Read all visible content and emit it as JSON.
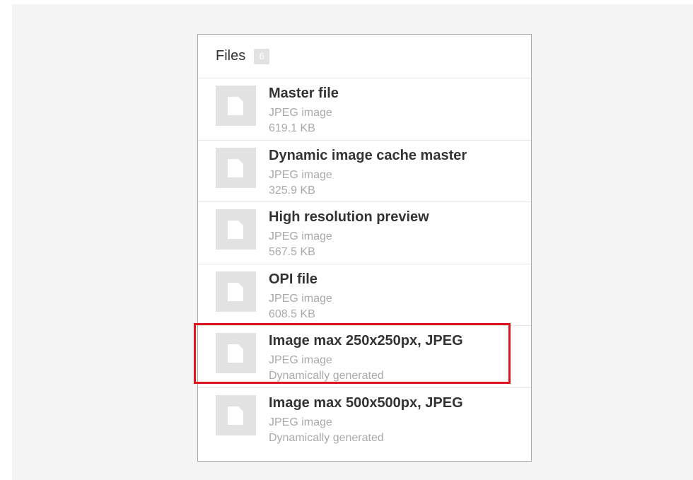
{
  "panel": {
    "title": "Files",
    "count": "6"
  },
  "files": [
    {
      "name": "Master file",
      "type": "JPEG image",
      "meta": "619.1 KB",
      "icon": "file-icon"
    },
    {
      "name": "Dynamic image cache master",
      "type": "JPEG image",
      "meta": "325.9 KB",
      "icon": "file-icon"
    },
    {
      "name": "High resolution preview",
      "type": "JPEG image",
      "meta": "567.5 KB",
      "icon": "file-icon"
    },
    {
      "name": "OPI file",
      "type": "JPEG image",
      "meta": "608.5 KB",
      "icon": "file-icon"
    },
    {
      "name": "Image max 250x250px, JPEG",
      "type": "JPEG image",
      "meta": "Dynamically generated",
      "icon": "file-icon"
    },
    {
      "name": "Image max 500x500px, JPEG",
      "type": "JPEG image",
      "meta": "Dynamically generated",
      "icon": "file-icon"
    }
  ],
  "highlight": {
    "target_index": 4,
    "color": "#e0141e"
  }
}
